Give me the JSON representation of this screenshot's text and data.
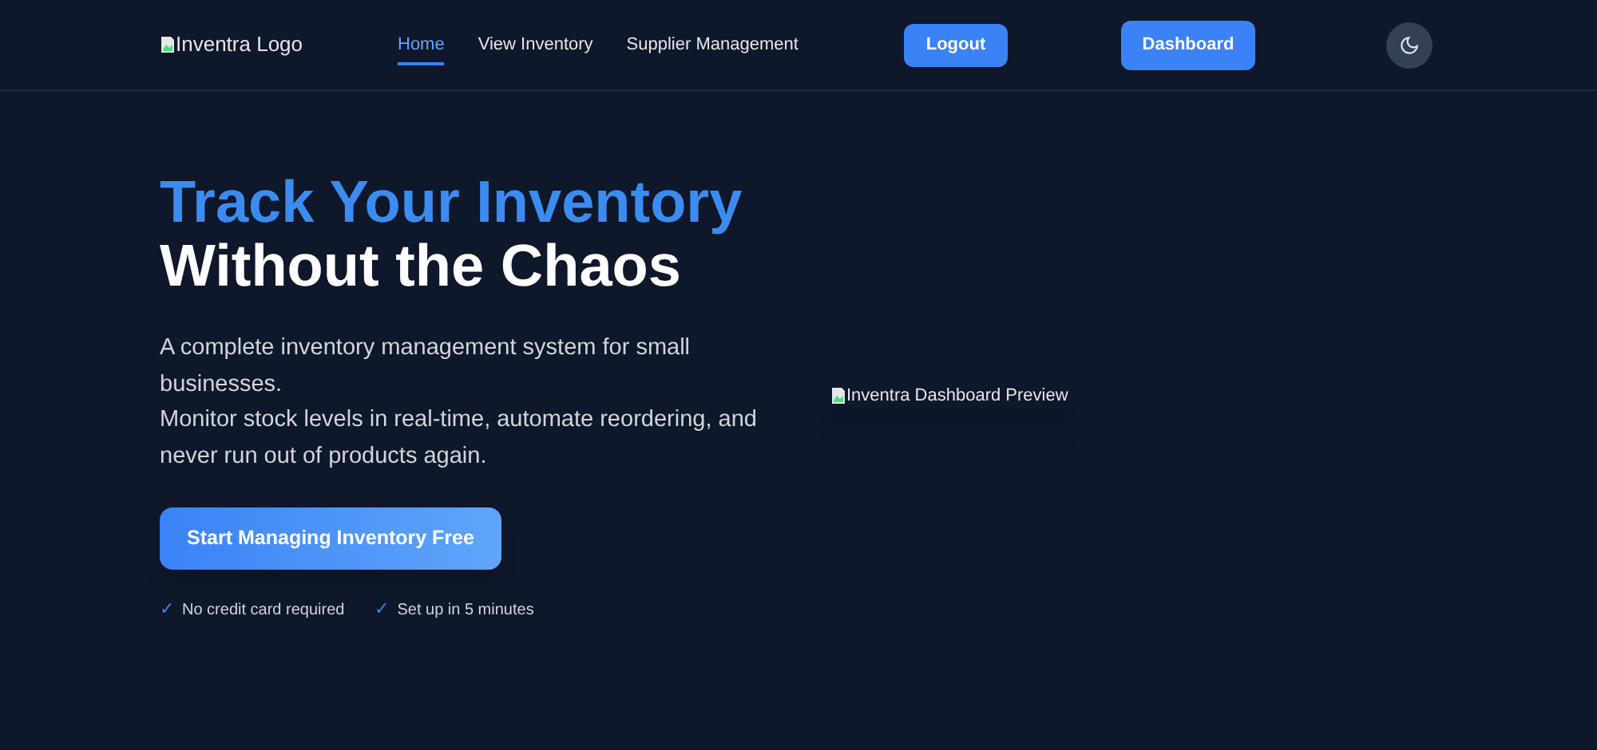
{
  "navbar": {
    "logo_alt": "Inventra Logo",
    "links": [
      {
        "label": "Home",
        "selected": true
      },
      {
        "label": "View Inventory",
        "selected": false
      },
      {
        "label": "Supplier Management",
        "selected": false
      }
    ],
    "logout": "Logout",
    "dashboard": "Dashboard"
  },
  "hero": {
    "title_highlight": "Track Your Inventory",
    "title_rest": "Without the Chaos",
    "description": [
      "A complete inventory management system for small businesses.",
      "Monitor stock levels in real-time, automate reordering, and never run out of products again."
    ],
    "cta": "Start Managing Inventory Free",
    "checks": [
      {
        "mark": "✓",
        "text": "No credit card required"
      },
      {
        "mark": "✓",
        "text": "Set up in 5 minutes"
      }
    ],
    "preview_alt": "Inventra Dashboard Preview"
  }
}
